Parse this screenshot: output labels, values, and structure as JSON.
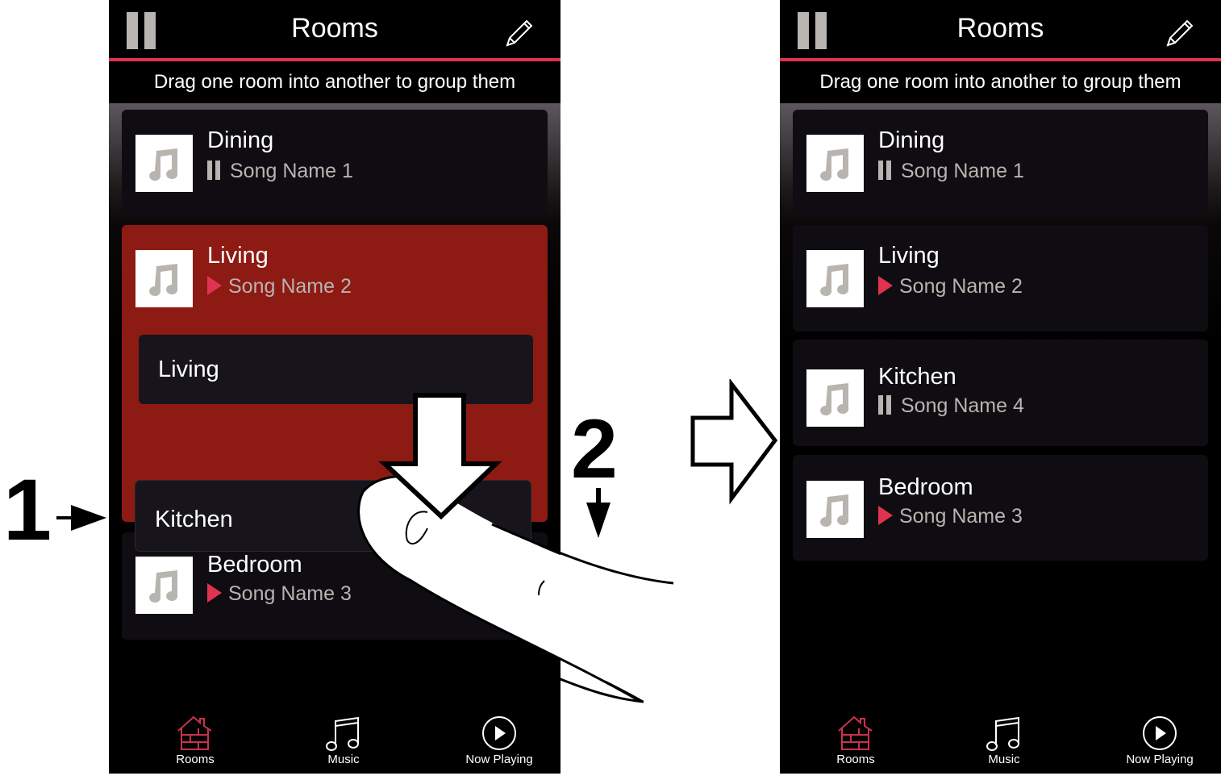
{
  "colors": {
    "accent": "#e0334f",
    "active_card": "#8e1a14",
    "card": "#0f0d11",
    "muted_text": "#b8b4b0"
  },
  "left_screen": {
    "header": {
      "title": "Rooms",
      "left_icon": "pause-icon",
      "right_icon": "pencil-edit-icon"
    },
    "hint": "Drag one room into another to group them",
    "rooms": [
      {
        "name": "Dining",
        "status": "paused",
        "song": "Song Name 1"
      },
      {
        "name": "Living",
        "status": "playing",
        "song": "Song Name 2",
        "highlighted": true
      },
      {
        "name": "Bedroom",
        "status": "playing",
        "song": "Song Name 3"
      }
    ],
    "drag_group": {
      "target_label": "Living",
      "dragged_label": "Kitchen"
    },
    "nav": [
      {
        "label": "Rooms",
        "icon": "house-icon",
        "active": true
      },
      {
        "label": "Music",
        "icon": "music-note-icon",
        "active": false
      },
      {
        "label": "Now Playing",
        "icon": "play-circle-icon",
        "active": false
      }
    ]
  },
  "right_screen": {
    "header": {
      "title": "Rooms",
      "left_icon": "pause-icon",
      "right_icon": "pencil-edit-icon"
    },
    "hint": "Drag one room into another to group them",
    "rooms": [
      {
        "name": "Dining",
        "status": "paused",
        "song": "Song Name 1"
      },
      {
        "name": "Living",
        "status": "playing",
        "song": "Song Name 2"
      },
      {
        "name": "Kitchen",
        "status": "paused",
        "song": "Song Name 4"
      },
      {
        "name": "Bedroom",
        "status": "playing",
        "song": "Song Name 3"
      }
    ],
    "nav": [
      {
        "label": "Rooms",
        "icon": "house-icon",
        "active": true
      },
      {
        "label": "Music",
        "icon": "music-note-icon",
        "active": false
      },
      {
        "label": "Now Playing",
        "icon": "play-circle-icon",
        "active": false
      }
    ]
  },
  "annotations": {
    "step1": "1",
    "step2": "2"
  }
}
